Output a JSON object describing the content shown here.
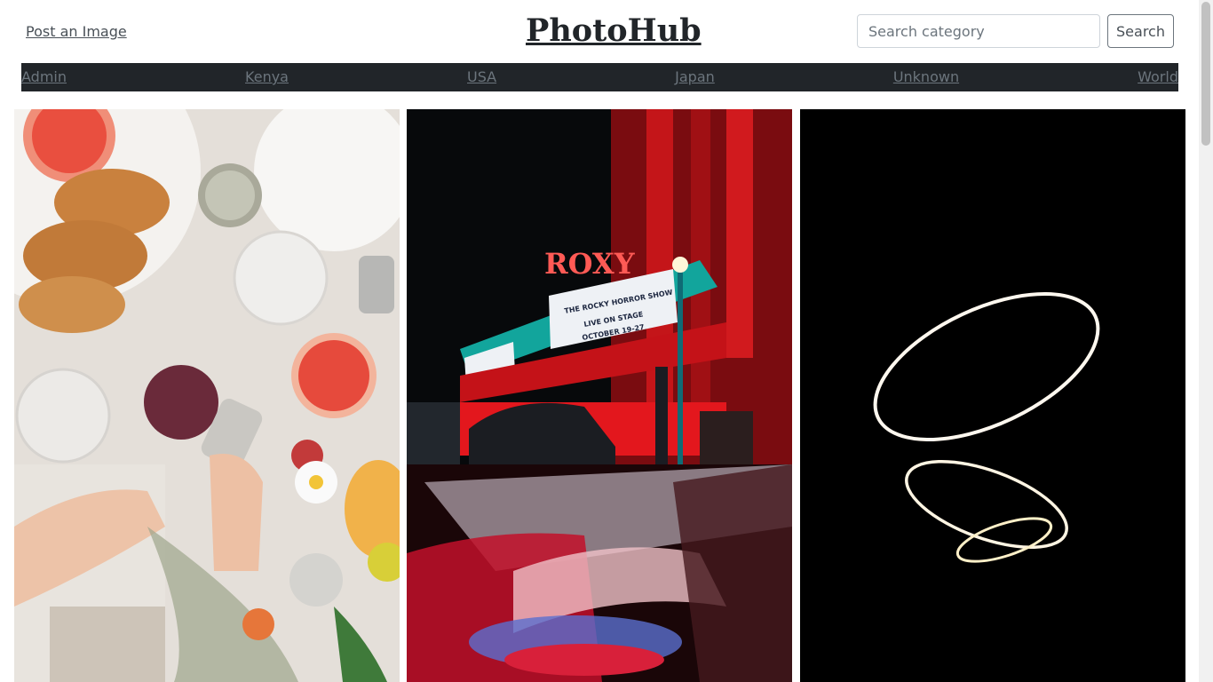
{
  "header": {
    "post_link": "Post an Image",
    "logo": "PhotoHub",
    "search_placeholder": "Search category",
    "search_button": "Search"
  },
  "nav": {
    "items": [
      "Admin",
      "Kenya",
      "USA",
      "Japan",
      "Unknown",
      "World"
    ]
  },
  "gallery": {
    "images": [
      {
        "name": "breakfast-table-photo"
      },
      {
        "name": "roxy-theater-photo",
        "sign": "ROXY",
        "marquee_line1": "THE ROCKY HORROR SHOW",
        "marquee_line2": "LIVE ON STAGE",
        "marquee_line3": "OCTOBER 19-27"
      },
      {
        "name": "light-rings-photo"
      }
    ]
  },
  "colors": {
    "nav_bg": "#212529",
    "link": "#6c757d"
  }
}
